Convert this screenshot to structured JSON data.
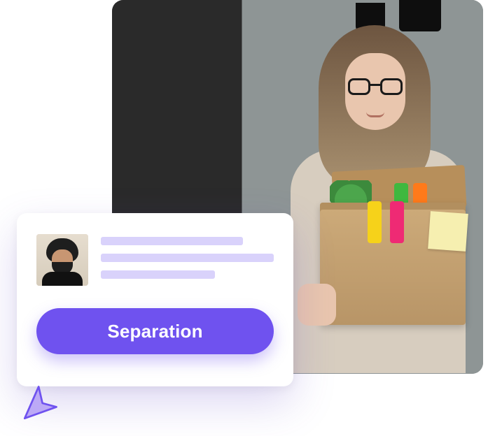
{
  "hero": {
    "alt": "Employee holding a cardboard box of desk items in an office"
  },
  "card": {
    "avatar_alt": "Employee profile photo",
    "placeholder_lines": 3,
    "action_label": "Separation"
  },
  "colors": {
    "accent": "#6f52ef",
    "placeholder": "#d9d2fb"
  }
}
